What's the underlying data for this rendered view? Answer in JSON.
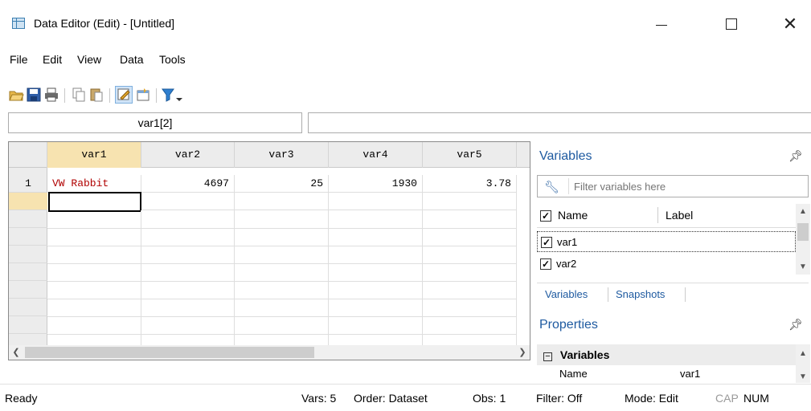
{
  "window": {
    "title": "Data Editor (Edit) - [Untitled]",
    "icon": "data-grid-icon"
  },
  "menu": [
    "File",
    "Edit",
    "View",
    "Data",
    "Tools"
  ],
  "toolbar": {
    "icons": [
      "open-icon",
      "save-icon",
      "print-icon",
      "copy-icon",
      "paste-icon",
      "edit-mode-icon",
      "browse-mode-icon",
      "filter-icon"
    ]
  },
  "cell_ref": "var1[2]",
  "cell_value": "",
  "grid": {
    "columns": [
      "var1",
      "var2",
      "var3",
      "var4",
      "var5"
    ],
    "rows": [
      {
        "num": "1",
        "cells": [
          "VW Rabbit",
          "4697",
          "25",
          "1930",
          "3.78"
        ]
      }
    ]
  },
  "variables_panel": {
    "title": "Variables",
    "filter_placeholder": "Filter variables here",
    "col_name": "Name",
    "col_label": "Label",
    "items": [
      {
        "name": "var1",
        "label": ""
      },
      {
        "name": "var2",
        "label": ""
      }
    ],
    "tabs": [
      "Variables",
      "Snapshots"
    ]
  },
  "properties_panel": {
    "title": "Properties",
    "group": "Variables",
    "rows": [
      {
        "key": "Name",
        "value": "var1"
      }
    ]
  },
  "status": {
    "ready": "Ready",
    "vars": "Vars: 5",
    "order": "Order: Dataset",
    "obs": "Obs: 1",
    "filter": "Filter: Off",
    "mode": "Mode: Edit",
    "cap": "CAP",
    "num": "NUM"
  }
}
